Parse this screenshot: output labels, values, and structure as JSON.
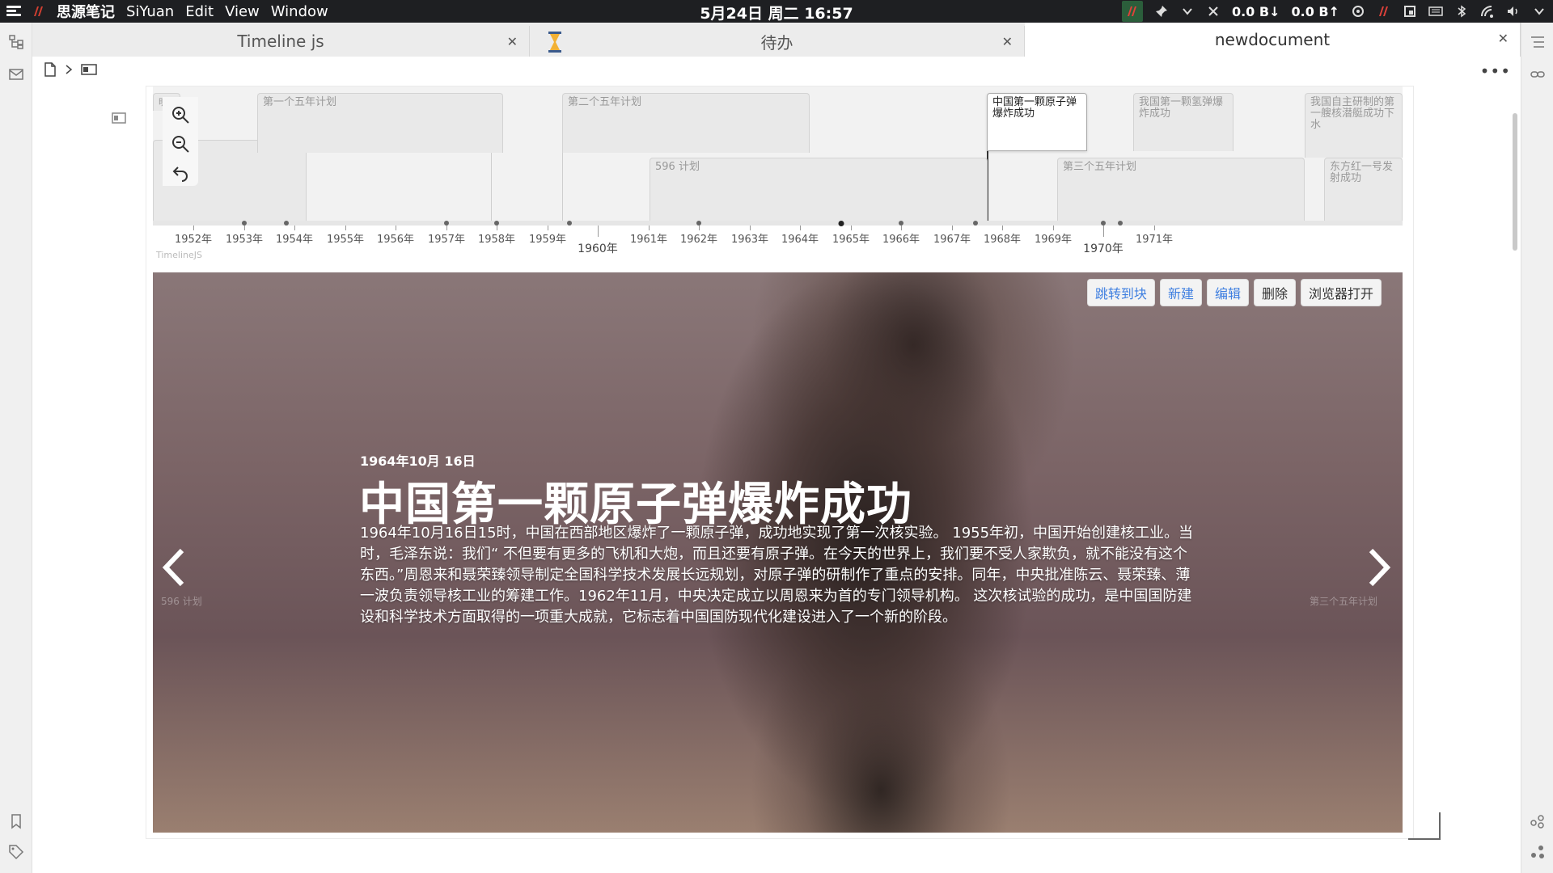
{
  "system_bar": {
    "app_name": "思源笔记",
    "menus": [
      "SiYuan",
      "Edit",
      "View",
      "Window"
    ],
    "clock": "5月24日 周二 16:57",
    "net_down": "0.0 B↓",
    "net_up": "0.0 B↑"
  },
  "tabs": [
    {
      "label": "Timeline js"
    },
    {
      "label": "待办"
    },
    {
      "label": "newdocument"
    }
  ],
  "timeline": {
    "brand": "TimelineJS",
    "markers": [
      {
        "label": "明"
      },
      {
        "label": "第一个五年计划"
      },
      {
        "label": "第二个五年计划"
      },
      {
        "label": "596 计划"
      },
      {
        "label": "中国第一颗原子弹爆炸成功"
      },
      {
        "label": "我国第一颗氢弹爆炸成功"
      },
      {
        "label": "第三个五年计划"
      },
      {
        "label": "我国自主研制的第一艘核潜艇成功下水"
      },
      {
        "label": "东方红一号发射成功"
      }
    ],
    "years": [
      "1952年",
      "1953年",
      "1954年",
      "1955年",
      "1956年",
      "1957年",
      "1958年",
      "1959年",
      "1961年",
      "1962年",
      "1963年",
      "1964年",
      "1965年",
      "1966年",
      "1967年",
      "1968年",
      "1969年",
      "1971年"
    ],
    "major_years": [
      "1960年",
      "1970年"
    ]
  },
  "slide": {
    "actions": [
      "跳转到块",
      "新建",
      "编辑",
      "删除",
      "浏览器打开"
    ],
    "date": "1964年10月 16日",
    "title": "中国第一颗原子弹爆炸成功",
    "text": "1964年10月16日15时，中国在西部地区爆炸了一颗原子弹，成功地实现了第一次核实验。 1955年初，中国开始创建核工业。当时，毛泽东说：我们“ 不但要有更多的飞机和大炮，而且还要有原子弹。在今天的世界上，我们要不受人家欺负，就不能没有这个东西。”周恩来和聂荣臻领导制定全国科学技术发展长远规划，对原子弹的研制作了重点的安排。同年，中央批准陈云、聂荣臻、薄一波负责领导核工业的筹建工作。1962年11月，中央决定成立以周恩来为首的专门领导机构。 这次核试验的成功，是中国国防建设和科学技术方面取得的一项重大成就，它标志着中国国防现代化建设进入了一个新的阶段。",
    "prev_label": "596 计划",
    "next_label": "第三个五年计划"
  }
}
